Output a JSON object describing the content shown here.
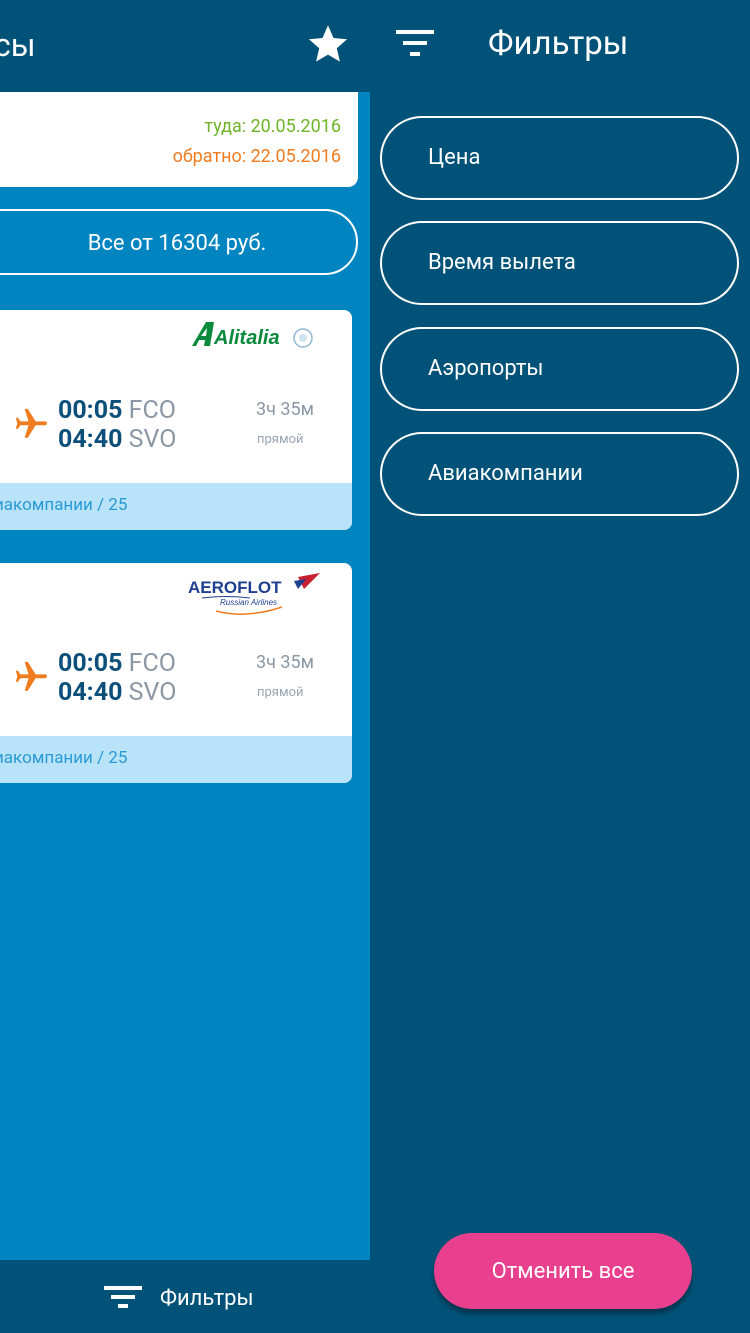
{
  "colors": {
    "dark_blue": "#005278",
    "main_blue": "#0085c0",
    "green_date": "#6eb52a",
    "orange_date": "#f07c20",
    "pink_button": "#e8408f",
    "card_footer": "#b9e3f9"
  },
  "main": {
    "title": "сы",
    "star_icon": "star-icon",
    "dates": {
      "outbound": "туда: 20.05.2016",
      "return": "обратно: 22.05.2016"
    },
    "all_button": "Все от 16304 руб.",
    "flights": [
      {
        "airline": "Alitalia",
        "dep_time": "00:05",
        "dep_code": "FCO",
        "arr_time": "04:40",
        "arr_code": "SVO",
        "duration": "3ч 35м",
        "type": "прямой",
        "footer": "иакомпании / 25"
      },
      {
        "airline": "Aeroflot",
        "logo_text": "AEROFLOT",
        "logo_subtext": "Russian Airlines",
        "dep_time": "00:05",
        "dep_code": "FCO",
        "arr_time": "04:40",
        "arr_code": "SVO",
        "duration": "3ч 35м",
        "type": "прямой",
        "footer": "иакомпании / 25"
      }
    ],
    "bottom_filter_label": "Фильтры"
  },
  "drawer": {
    "title": "Фильтры",
    "filters": [
      "Цена",
      "Время вылета",
      "Аэропорты",
      "Авиакомпании"
    ],
    "reset_button": "Отменить все"
  }
}
